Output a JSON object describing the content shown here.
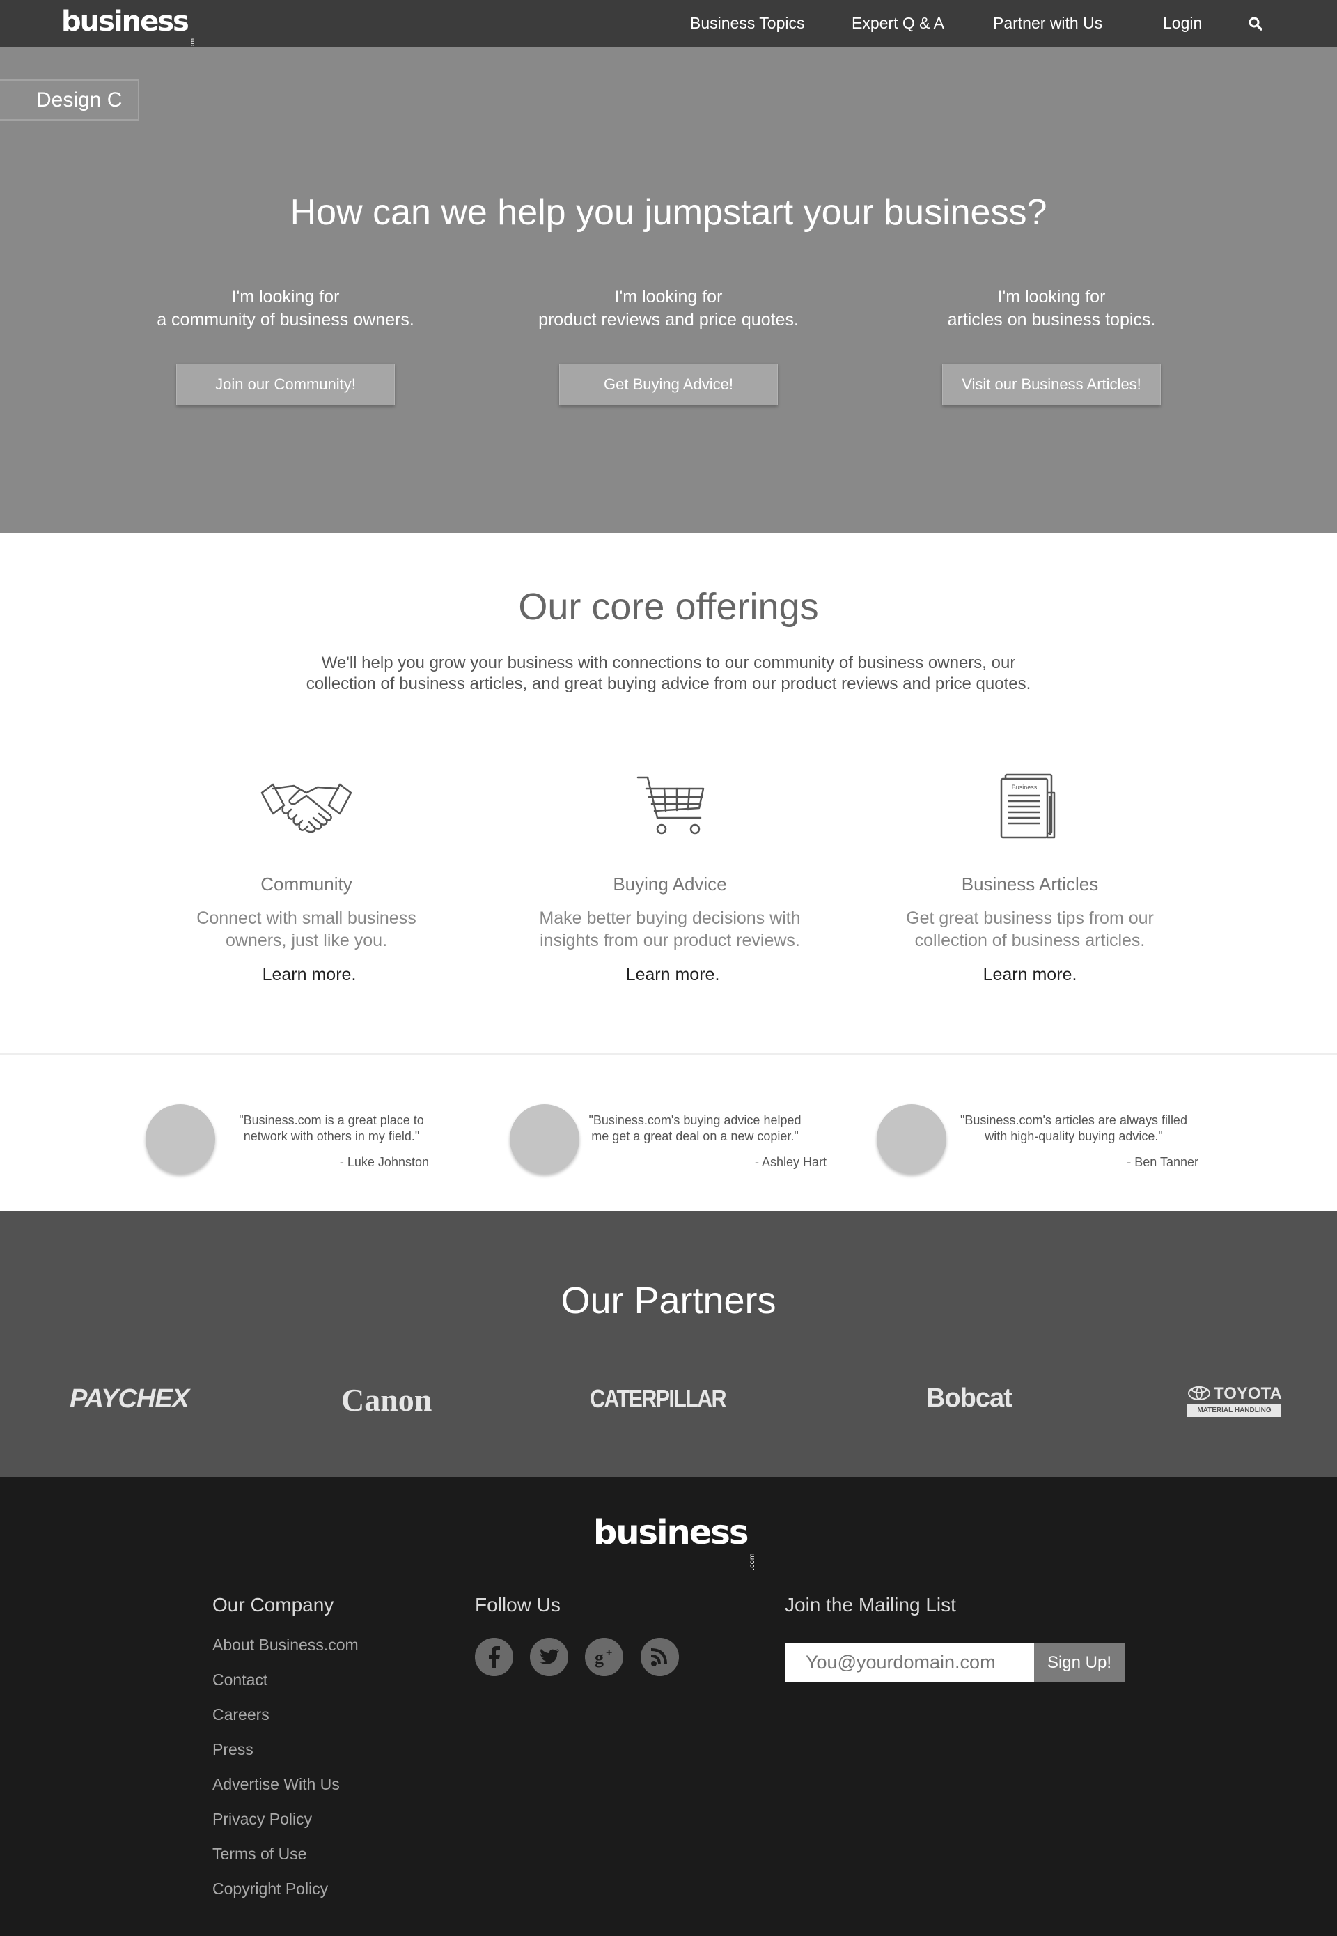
{
  "nav": {
    "brand": "business",
    "brand_suffix": ".com",
    "links": [
      "Business Topics",
      "Expert Q & A",
      "Partner with Us",
      "Login"
    ],
    "search_icon": "search-icon"
  },
  "hero": {
    "design_tag": "Design C",
    "title": "How can we help you jumpstart your business?",
    "columns": [
      {
        "line1": "I'm looking for",
        "line2": "a community of business owners.",
        "button": "Join our Community!"
      },
      {
        "line1": "I'm looking for",
        "line2": "product reviews and price quotes.",
        "button": "Get Buying Advice!"
      },
      {
        "line1": "I'm looking for",
        "line2": "articles on business topics.",
        "button": "Visit our Business Articles!"
      }
    ]
  },
  "offerings": {
    "title": "Our core offerings",
    "subtitle_line1": "We'll help you grow your business with connections to our community of business owners, our",
    "subtitle_line2": "collection of business articles, and great buying advice from our product reviews and price quotes.",
    "items": [
      {
        "icon": "handshake-icon",
        "title": "Community",
        "text1": "Connect with small business",
        "text2": "owners, just like you.",
        "link": "Learn more."
      },
      {
        "icon": "shopping-cart-icon",
        "title": "Buying Advice",
        "text1": "Make better buying decisions with",
        "text2": "insights from our product reviews.",
        "link": "Learn more."
      },
      {
        "icon": "newspaper-icon",
        "title": "Business Articles",
        "text1": "Get great business tips from our",
        "text2": "collection of business articles.",
        "link": "Learn more.",
        "icon_label": "Business"
      }
    ]
  },
  "testimonials": [
    {
      "line1": "\"Business.com is a great place to",
      "line2": "network with others in my field.\"",
      "author": "- Luke Johnston"
    },
    {
      "line1": "\"Business.com's buying advice helped",
      "line2": "me get a great deal on a new copier.\"",
      "author": "- Ashley Hart"
    },
    {
      "line1": "\"Business.com's articles are always filled",
      "line2": "with high-quality buying advice.\"",
      "author": "- Ben Tanner"
    }
  ],
  "partners": {
    "title": "Our Partners",
    "logos": [
      "PAYCHEX",
      "Canon",
      "CATERPILLAR",
      "Bobcat",
      "TOYOTA",
      "MATERIAL HANDLING"
    ]
  },
  "footer": {
    "brand": "business",
    "brand_suffix": ".com",
    "company_heading": "Our Company",
    "company_links": [
      "About Business.com",
      "Contact",
      "Careers",
      "Press",
      "Advertise With Us",
      "Privacy Policy",
      "Terms of Use",
      "Copyright Policy"
    ],
    "follow_heading": "Follow Us",
    "social_icons": [
      "facebook-icon",
      "twitter-icon",
      "google-plus-icon",
      "rss-icon"
    ],
    "mailing_heading": "Join the Mailing List",
    "mailing_placeholder": "You@yourdomain.com",
    "mailing_button": "Sign Up!"
  }
}
